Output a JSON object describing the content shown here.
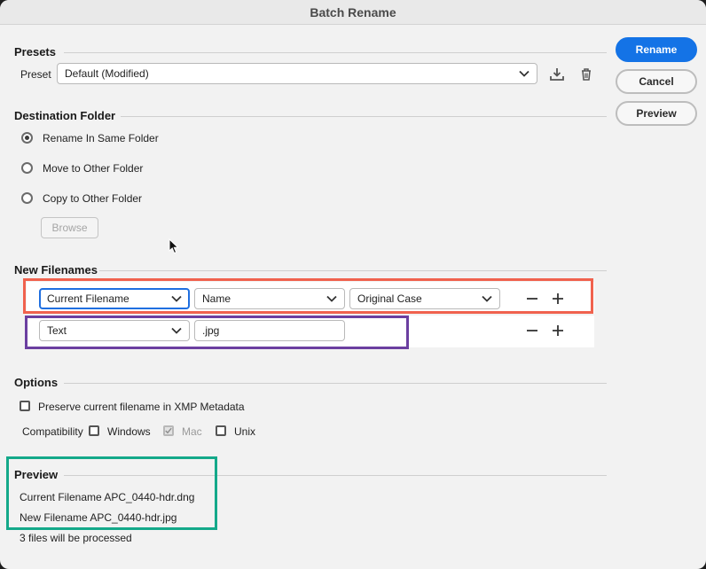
{
  "window": {
    "title": "Batch Rename"
  },
  "buttons": {
    "rename": "Rename",
    "cancel": "Cancel",
    "preview": "Preview",
    "browse": "Browse"
  },
  "presets": {
    "title": "Presets",
    "preset_label": "Preset",
    "preset_value": "Default (Modified)"
  },
  "destination": {
    "title": "Destination Folder",
    "options": [
      {
        "label": "Rename In Same Folder",
        "selected": true
      },
      {
        "label": "Move to Other Folder",
        "selected": false
      },
      {
        "label": "Copy to Other Folder",
        "selected": false
      }
    ]
  },
  "new_filenames": {
    "title": "New Filenames",
    "rows": [
      {
        "type": "Current Filename",
        "field2": "Name",
        "field3": "Original Case"
      },
      {
        "type": "Text",
        "text_value": ".jpg"
      }
    ]
  },
  "options": {
    "title": "Options",
    "preserve_label": "Preserve current filename in XMP Metadata",
    "compat_label": "Compatibility",
    "windows_label": "Windows",
    "mac_label": "Mac",
    "unix_label": "Unix"
  },
  "preview": {
    "title": "Preview",
    "current": "Current Filename APC_0440-hdr.dng",
    "new": "New Filename APC_0440-hdr.jpg",
    "count": "3 files will be processed"
  },
  "colors": {
    "accent": "#1473e6",
    "highlight_red": "#f0624e",
    "highlight_purple": "#6b3fa0",
    "highlight_teal": "#14a98a"
  },
  "icons": {
    "preset_save": "download-icon",
    "preset_delete": "trash-icon",
    "remove_row": "minus-icon",
    "add_row": "plus-icon",
    "cursor": "mouse-pointer-icon"
  }
}
